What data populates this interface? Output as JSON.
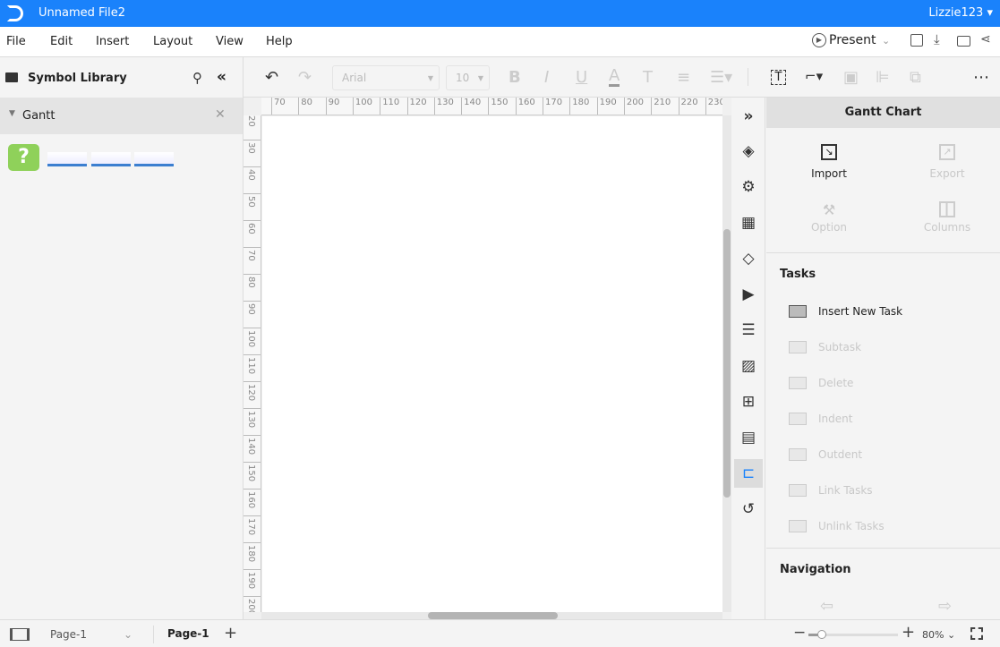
{
  "app": {
    "title": "Unnamed File2",
    "user": "Lizzie123",
    "accent": "#1a82fb"
  },
  "menu": [
    "File",
    "Edit",
    "Insert",
    "Layout",
    "View",
    "Help"
  ],
  "header_actions": {
    "present": "Present"
  },
  "left_panel": {
    "title": "Symbol Library",
    "category": "Gantt"
  },
  "toolbar": {
    "font": "Arial",
    "size": "10"
  },
  "ruler": {
    "top": [
      "70",
      "80",
      "90",
      "100",
      "110",
      "120",
      "130",
      "140",
      "150",
      "160",
      "170",
      "180",
      "190",
      "200",
      "210",
      "220",
      "230"
    ],
    "left": [
      "20",
      "30",
      "40",
      "50",
      "60",
      "70",
      "80",
      "90",
      "100",
      "110",
      "120",
      "130",
      "140",
      "150",
      "160",
      "170",
      "180",
      "190",
      "200"
    ]
  },
  "side_icons": [
    "paint-bucket-icon",
    "settings-page-icon",
    "grid-icon",
    "layers-icon",
    "presentation-icon",
    "database-icon",
    "image-icon",
    "org-chart-icon",
    "table-icon",
    "gantt-icon",
    "history-icon"
  ],
  "right_panel": {
    "title": "Gantt Chart",
    "import": "Import",
    "export": "Export",
    "option": "Option",
    "columns": "Columns",
    "tasks_title": "Tasks",
    "tasks": [
      "Insert New Task",
      "Subtask",
      "Delete",
      "Indent",
      "Outdent",
      "Link Tasks",
      "Unlink Tasks"
    ],
    "navigation_title": "Navigation"
  },
  "bottom": {
    "page_select": "Page-1",
    "page_tab": "Page-1",
    "zoom": "80%",
    "zoom_fraction": 0.15
  }
}
